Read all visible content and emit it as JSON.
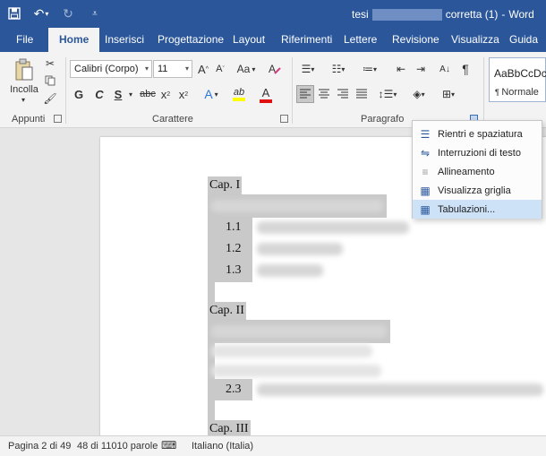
{
  "titlebar": {
    "doc_title_start": "tesi",
    "doc_title_end": "corretta (1)",
    "separator": "-",
    "app_name": "Word",
    "qat": [
      "save-icon",
      "undo-icon",
      "redo-icon",
      "customize-icon"
    ]
  },
  "tabs": [
    "File",
    "Home",
    "Inserisci",
    "Progettazione",
    "Layout",
    "Riferimenti",
    "Lettere",
    "Revisione",
    "Visualizza",
    "Guida"
  ],
  "active_tab": "Home",
  "ribbon": {
    "clipboard": {
      "paste_label": "Incolla",
      "group_label": "Appunti"
    },
    "font": {
      "font_name": "Calibri (Corpo)",
      "font_size": "11",
      "grow": "A",
      "shrink": "A",
      "case": "Aa",
      "bold": "G",
      "italic": "C",
      "underline": "S",
      "strike": "abc",
      "subscript": "x",
      "superscript": "x",
      "effects": "A",
      "highlight": "ab",
      "color": "A",
      "group_label": "Carattere"
    },
    "paragraph": {
      "group_label": "Paragrafo"
    },
    "styles": {
      "sample": "AaBbCcDc",
      "style_name": "Normale"
    }
  },
  "document": {
    "cap1": "Cap. I",
    "items_cap1": [
      "1.1",
      "1.2",
      "1.3"
    ],
    "cap2": "Cap. II",
    "item_cap2": "2.3",
    "cap3": "Cap. III"
  },
  "menu": {
    "items": [
      {
        "label": "Rientri e spaziatura",
        "icon": "indent-spacing-icon"
      },
      {
        "label": "Interruzioni di testo",
        "icon": "line-breaks-icon"
      },
      {
        "label": "Allineamento",
        "icon": "alignment-icon"
      },
      {
        "label": "Visualizza griglia",
        "icon": "grid-icon"
      },
      {
        "label": "Tabulazioni...",
        "icon": "tabs-icon"
      }
    ],
    "highlighted_index": 4
  },
  "statusbar": {
    "page": "Pagina 2 di 49",
    "words": "48 di 11010 parole",
    "language": "Italiano (Italia)"
  },
  "colors": {
    "brand": "#2b579a",
    "highlight_yellow": "#ffff00",
    "font_red": "#e01010",
    "selection": "#c9c9c9"
  }
}
